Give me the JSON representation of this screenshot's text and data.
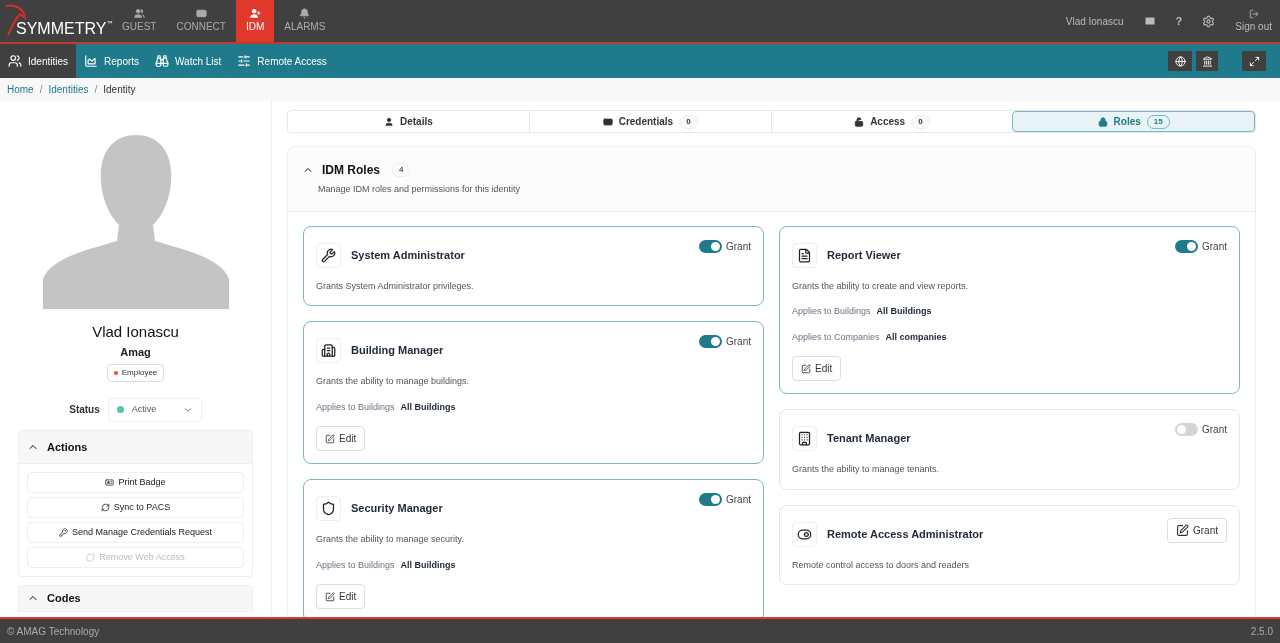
{
  "header": {
    "logo": "SYMMETRY",
    "logo_mark": "™",
    "modules": [
      {
        "label": "GUEST",
        "selected": false
      },
      {
        "label": "CONNECT",
        "selected": false
      },
      {
        "label": "IDM",
        "selected": true
      },
      {
        "label": "ALARMS",
        "selected": false
      }
    ],
    "user": "Vlad Ionascu",
    "help": "?",
    "sign_out": "Sign out"
  },
  "subnav": [
    {
      "label": "Identities",
      "selected": true
    },
    {
      "label": "Reports",
      "selected": false
    },
    {
      "label": "Watch List",
      "selected": false
    },
    {
      "label": "Remote Access",
      "selected": false
    }
  ],
  "breadcrumb": [
    {
      "label": "Home"
    },
    {
      "separator": "/",
      "label": "Identities"
    },
    {
      "separator": "/",
      "label": "Identity"
    }
  ],
  "profile": {
    "name": "Vlad Ionascu",
    "company": "Amag",
    "type": {
      "label": "Employee",
      "color": "#e8502f"
    },
    "status_label": "Status",
    "status": {
      "value": "Active",
      "color": "#4fc99a"
    }
  },
  "actions": {
    "title": "Actions",
    "expanded": true,
    "buttons": [
      {
        "label": "Print Badge",
        "disabled": false
      },
      {
        "label": "Sync to PACS",
        "disabled": false
      },
      {
        "label": "Send Manage Credentials Request",
        "disabled": false
      },
      {
        "label": "Remove Web Access",
        "disabled": true
      }
    ]
  },
  "codes": {
    "title": "Codes",
    "expanded": true
  },
  "tabs": [
    {
      "label": "Details",
      "selected": false
    },
    {
      "label": "Credentials",
      "count": "0",
      "selected": false
    },
    {
      "label": "Access",
      "count": "0",
      "selected": false
    },
    {
      "label": "Roles",
      "count": "15",
      "selected": true
    }
  ],
  "section": {
    "title": "IDM Roles",
    "count": "4",
    "expanded": true,
    "subtitle": "Manage IDM roles and permissions for this identity"
  },
  "columns": [
    [
      {
        "kind": "toggle",
        "title": "System Administrator",
        "granted": true,
        "grant_label": "Grant",
        "description": "Grants System Administrator privileges."
      },
      {
        "kind": "toggle",
        "title": "Building Manager",
        "granted": true,
        "grant_label": "Grant",
        "description": "Grants the ability to manage buildings.",
        "scopes": [
          {
            "label": "Applies to Buildings",
            "value": "All Buildings"
          }
        ],
        "edit": "Edit"
      },
      {
        "kind": "toggle",
        "title": "Security Manager",
        "granted": true,
        "grant_label": "Grant",
        "description": "Grants the ability to manage security.",
        "scopes": [
          {
            "label": "Applies to Buildings",
            "value": "All Buildings"
          }
        ],
        "edit": "Edit"
      }
    ],
    [
      {
        "kind": "toggle",
        "title": "Report Viewer",
        "granted": true,
        "grant_label": "Grant",
        "description": "Grants the ability to create and view reports.",
        "scopes": [
          {
            "label": "Applies to Buildings",
            "value": "All Buildings"
          },
          {
            "label": "Applies to Companies",
            "value": "All companies"
          }
        ],
        "edit": "Edit"
      },
      {
        "kind": "toggle",
        "title": "Tenant Manager",
        "granted": false,
        "grant_label": "Grant",
        "description": "Grants the ability to manage tenants."
      },
      {
        "kind": "button",
        "title": "Remote Access Administrator",
        "granted": false,
        "grant_label": "Grant",
        "description": "Remote control access to doors and readers"
      }
    ]
  ],
  "footer": {
    "copyright": "© AMAG Technology",
    "version": "2.5.0"
  }
}
